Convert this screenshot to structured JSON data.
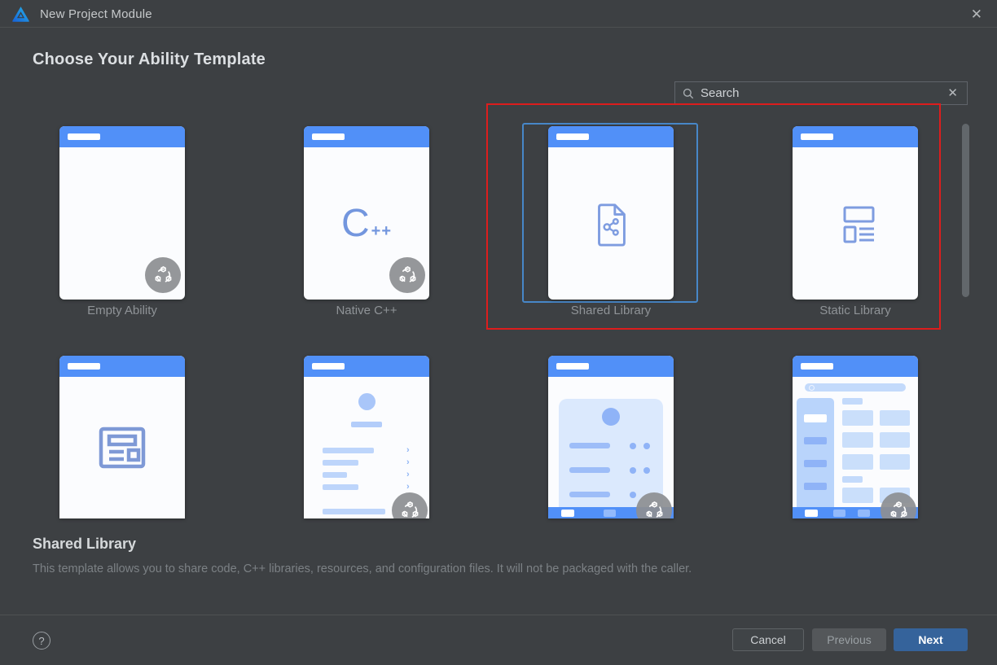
{
  "window": {
    "title": "New Project Module",
    "close_icon": "✕"
  },
  "page": {
    "heading": "Choose Your Ability Template"
  },
  "search": {
    "placeholder": "Search",
    "clear_icon": "✕"
  },
  "templates": {
    "row1": [
      {
        "label": "Empty Ability",
        "icon": "empty-ability-card",
        "has_badge": true,
        "selected": false
      },
      {
        "label": "Native C++",
        "icon": "native-cpp-card",
        "icon_text": "C++",
        "has_badge": true,
        "selected": false
      },
      {
        "label": "Shared Library",
        "icon": "shared-library-card",
        "has_badge": false,
        "selected": true
      },
      {
        "label": "Static Library",
        "icon": "static-library-card",
        "has_badge": false,
        "selected": false
      }
    ],
    "row2": [
      {
        "icon": "form-widget-card",
        "has_badge": false
      },
      {
        "icon": "about-list-card",
        "has_badge": true
      },
      {
        "icon": "profile-list-card",
        "has_badge": true
      },
      {
        "icon": "browse-grid-card",
        "has_badge": true
      }
    ]
  },
  "selected_template": {
    "name": "Shared Library",
    "description": "This template allows you to share code, C++ libraries, resources, and configuration files. It will not be packaged with the caller."
  },
  "footer": {
    "help_icon": "?",
    "cancel_label": "Cancel",
    "previous_label": "Previous",
    "next_label": "Next"
  },
  "annotation": {
    "type": "highlight-rectangle",
    "color": "#dd1d1d"
  },
  "colors": {
    "dialog_background": "#3d4043",
    "card_header_blue": "#5190f8",
    "card_background": "#fbfcfe",
    "selection_border_blue": "#4787c8",
    "annotation_red": "#dd1d1d",
    "next_button_blue": "#35639b",
    "icon_blue": "#7e9ce0",
    "badge_gray": "#8d8f92"
  }
}
